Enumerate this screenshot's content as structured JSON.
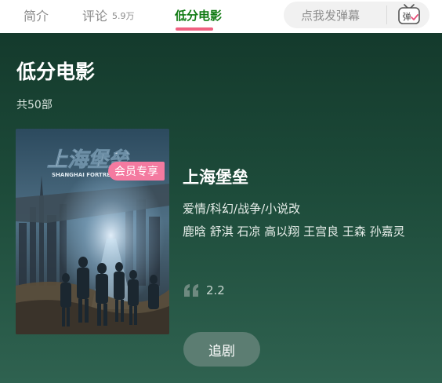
{
  "tabs": {
    "intro": "简介",
    "comments": "评论",
    "comments_count": "5.9万",
    "low_score": "低分电影"
  },
  "danmaku": {
    "placeholder": "点我发弹幕",
    "icon_label": "弹",
    "icon": "danmaku-tv-icon"
  },
  "panel": {
    "title": "低分电影",
    "count": "共50部"
  },
  "movie": {
    "badge": "会员专享",
    "title": "上海堡垒",
    "genres": "爱情/科幻/战争/小说改",
    "cast": "鹿晗 舒淇 石凉 高以翔 王宫良 王森 孙嘉灵",
    "rating": "2.2",
    "rating_icon": "quote-icon",
    "follow_label": "追剧",
    "poster_title": "上海堡垒",
    "poster_subtitle": "SHANGHAI FORTRESS"
  },
  "colors": {
    "accent_tab": "#0f7a12",
    "underline": "#f06080",
    "panel_bg": "#1d4b3a",
    "badge_bg": "#f47aa0",
    "button_bg": "#5c7d72"
  }
}
